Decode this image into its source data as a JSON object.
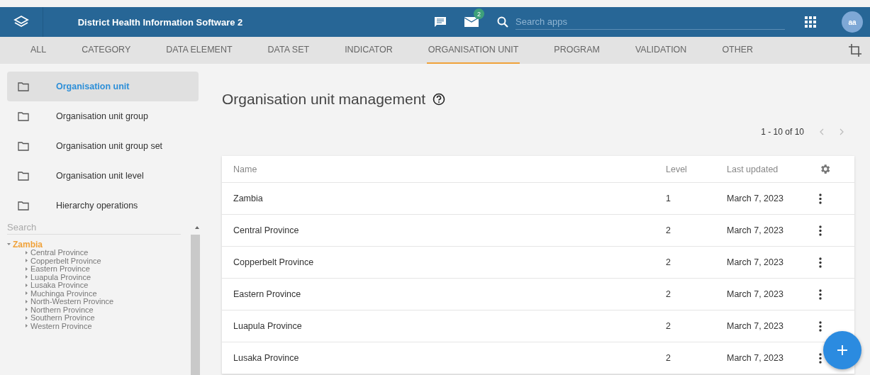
{
  "header": {
    "title": "District Health Information Software 2",
    "messages_badge": "2",
    "search": {
      "placeholder": "Search apps"
    },
    "avatar": "aa"
  },
  "tabs": [
    {
      "label": "ALL",
      "selected": false
    },
    {
      "label": "CATEGORY",
      "selected": false
    },
    {
      "label": "DATA ELEMENT",
      "selected": false
    },
    {
      "label": "DATA SET",
      "selected": false
    },
    {
      "label": "INDICATOR",
      "selected": false
    },
    {
      "label": "ORGANISATION UNIT",
      "selected": true
    },
    {
      "label": "PROGRAM",
      "selected": false
    },
    {
      "label": "VALIDATION",
      "selected": false
    },
    {
      "label": "OTHER",
      "selected": false
    }
  ],
  "sidebar": {
    "items": [
      {
        "label": "Organisation unit",
        "selected": true
      },
      {
        "label": "Organisation unit group",
        "selected": false
      },
      {
        "label": "Organisation unit group set",
        "selected": false
      },
      {
        "label": "Organisation unit level",
        "selected": false
      },
      {
        "label": "Hierarchy operations",
        "selected": false
      }
    ],
    "search": {
      "placeholder": "Search"
    },
    "tree": [
      {
        "label": "Zambia",
        "selected": true,
        "expanded": true,
        "children": [
          {
            "label": "Central Province",
            "selected": false,
            "expanded": false
          },
          {
            "label": "Copperbelt Province",
            "selected": false,
            "expanded": false
          },
          {
            "label": "Eastern Province",
            "selected": false,
            "expanded": false
          },
          {
            "label": "Luapula Province",
            "selected": false,
            "expanded": false
          },
          {
            "label": "Lusaka Province",
            "selected": false,
            "expanded": false
          },
          {
            "label": "Muchinga Province",
            "selected": false,
            "expanded": false
          },
          {
            "label": "North-Western Province",
            "selected": false,
            "expanded": false
          },
          {
            "label": "Northern Province",
            "selected": false,
            "expanded": false
          },
          {
            "label": "Southern Province",
            "selected": false,
            "expanded": false
          },
          {
            "label": "Western Province",
            "selected": false,
            "expanded": false
          }
        ]
      }
    ]
  },
  "main": {
    "title": "Organisation unit management",
    "pager": "1 - 10 of 10",
    "table": {
      "columns": [
        "Name",
        "Level",
        "Last updated"
      ],
      "rows": [
        [
          "Zambia",
          "1",
          "March 7, 2023"
        ],
        [
          "Central Province",
          "2",
          "March 7, 2023"
        ],
        [
          "Copperbelt Province",
          "2",
          "March 7, 2023"
        ],
        [
          "Eastern Province",
          "2",
          "March 7, 2023"
        ],
        [
          "Luapula Province",
          "2",
          "March 7, 2023"
        ],
        [
          "Lusaka Province",
          "2",
          "March 7, 2023"
        ]
      ]
    }
  }
}
